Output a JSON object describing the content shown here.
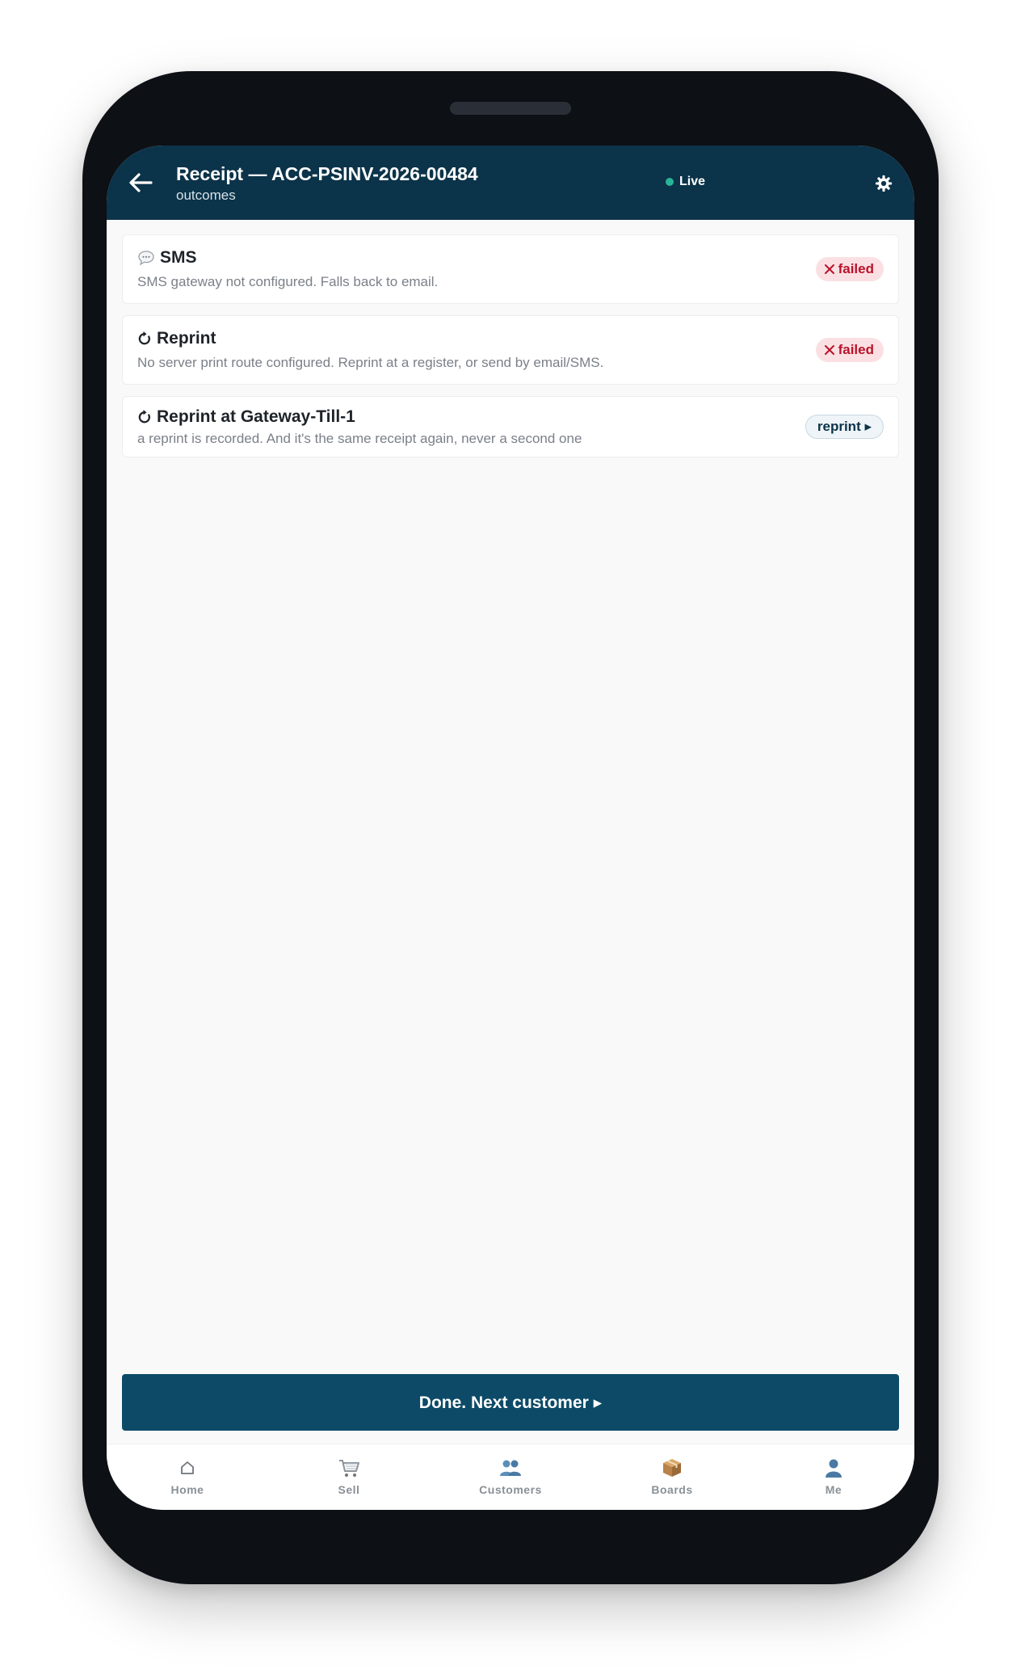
{
  "header": {
    "title": "Receipt — ACC-PSINV-2026-00484",
    "subtitle": "outcomes",
    "status": "Live"
  },
  "cards": [
    {
      "icon": "speech-bubble-icon",
      "title": "SMS",
      "description": "SMS gateway not configured. Falls back to email.",
      "badge": "failed",
      "badge_icon": "x-icon"
    },
    {
      "icon": "refresh-icon",
      "title": "Reprint",
      "description": "No server print route configured. Reprint at a register, or send by email/SMS.",
      "badge": "failed",
      "badge_icon": "x-icon"
    },
    {
      "icon": "refresh-icon",
      "title": "Reprint at Gateway-Till-1",
      "description": "a reprint is recorded. And it's the same receipt again, never a second one",
      "badge": "reprint ▸"
    }
  ],
  "primary_action": {
    "label": "Done. Next customer ▸"
  },
  "nav": [
    {
      "label": "Home",
      "icon": "home-icon"
    },
    {
      "label": "Sell",
      "icon": "cart-icon"
    },
    {
      "label": "Customers",
      "icon": "people-icon"
    },
    {
      "label": "Boards",
      "icon": "box-icon"
    },
    {
      "label": "Me",
      "icon": "person-icon"
    }
  ],
  "colors": {
    "header_bg": "#0b3349",
    "primary_button": "#0c4a68",
    "live_dot": "#2ab596",
    "failed_badge_bg": "#fbe0e3",
    "failed_badge_text": "#b8142b"
  }
}
